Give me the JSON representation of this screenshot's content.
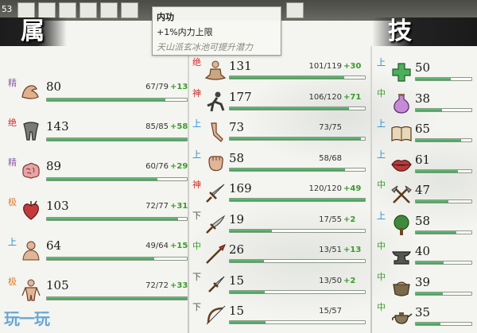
{
  "topbar": {
    "number": "53"
  },
  "sections": {
    "left_title": "属",
    "right_title": "技"
  },
  "tooltip": {
    "title": "内功",
    "effect": "+1%内力上限",
    "hint": "天山派玄冰池可提升潜力"
  },
  "watermark": "玩一玩",
  "colors": {
    "tier_jing": "#8b5fa8",
    "tier_jue": "#d42b2b",
    "tier_ji": "#e07a2a",
    "tier_shang": "#2a8fd0",
    "tier_shen": "#c8302a",
    "tier_xia": "#555555",
    "tier_zhong": "#3c9a2c",
    "bonus": "#3c9a2c",
    "bar_fill": "#4aa85f"
  },
  "attributes": [
    {
      "tier": "精",
      "tier_color": "tier_jing",
      "icon": "flexed-arm-icon",
      "value": "80",
      "current": 67,
      "max": 79,
      "fraction": "67/79",
      "bonus": "+13"
    },
    {
      "tier": "绝",
      "tier_color": "tier_jue",
      "icon": "legs-icon",
      "value": "143",
      "current": 85,
      "max": 85,
      "fraction": "85/85",
      "bonus": "+58"
    },
    {
      "tier": "精",
      "tier_color": "tier_jing",
      "icon": "brain-icon",
      "value": "89",
      "current": 60,
      "max": 76,
      "fraction": "60/76",
      "bonus": "+29"
    },
    {
      "tier": "极",
      "tier_color": "tier_ji",
      "icon": "heart-icon",
      "value": "103",
      "current": 72,
      "max": 77,
      "fraction": "72/77",
      "bonus": "+31"
    },
    {
      "tier": "上",
      "tier_color": "tier_shang",
      "icon": "bust-icon",
      "value": "64",
      "current": 49,
      "max": 64,
      "fraction": "49/64",
      "bonus": "+15"
    },
    {
      "tier": "极",
      "tier_color": "tier_ji",
      "icon": "body-icon",
      "value": "105",
      "current": 72,
      "max": 72,
      "fraction": "72/72",
      "bonus": "+33"
    }
  ],
  "martial": [
    {
      "tier": "绝",
      "tier_color": "tier_jue",
      "icon": "meditation-icon",
      "value": "131",
      "current": 101,
      "max": 119,
      "fraction": "101/119",
      "bonus": "+30"
    },
    {
      "tier": "神",
      "tier_color": "tier_shen",
      "icon": "leaping-figure-icon",
      "value": "177",
      "current": 106,
      "max": 120,
      "fraction": "106/120",
      "bonus": "+71"
    },
    {
      "tier": "上",
      "tier_color": "tier_shang",
      "icon": "kicking-leg-icon",
      "value": "73",
      "current": 73,
      "max": 75,
      "fraction": "73/75",
      "bonus": ""
    },
    {
      "tier": "上",
      "tier_color": "tier_shang",
      "icon": "fist-icon",
      "value": "58",
      "current": 58,
      "max": 68,
      "fraction": "58/68",
      "bonus": ""
    },
    {
      "tier": "神",
      "tier_color": "tier_shen",
      "icon": "sword-icon",
      "value": "169",
      "current": 120,
      "max": 120,
      "fraction": "120/120",
      "bonus": "+49"
    },
    {
      "tier": "下",
      "tier_color": "tier_xia",
      "icon": "broadsword-icon",
      "value": "19",
      "current": 17,
      "max": 55,
      "fraction": "17/55",
      "bonus": "+2"
    },
    {
      "tier": "中",
      "tier_color": "tier_zhong",
      "icon": "spear-icon",
      "value": "26",
      "current": 13,
      "max": 51,
      "fraction": "13/51",
      "bonus": "+13"
    },
    {
      "tier": "下",
      "tier_color": "tier_xia",
      "icon": "dagger-icon",
      "value": "15",
      "current": 13,
      "max": 50,
      "fraction": "13/50",
      "bonus": "+2"
    },
    {
      "tier": "下",
      "tier_color": "tier_xia",
      "icon": "bow-icon",
      "value": "15",
      "current": 15,
      "max": 57,
      "fraction": "15/57",
      "bonus": ""
    }
  ],
  "skills": [
    {
      "tier": "上",
      "tier_color": "tier_shang",
      "icon": "medical-cross-icon",
      "value": "50",
      "current": 50,
      "max": 80
    },
    {
      "tier": "中",
      "tier_color": "tier_zhong",
      "icon": "potion-flask-icon",
      "value": "38",
      "current": 38,
      "max": 80
    },
    {
      "tier": "上",
      "tier_color": "tier_shang",
      "icon": "book-icon",
      "value": "65",
      "current": 65,
      "max": 80
    },
    {
      "tier": "上",
      "tier_color": "tier_shang",
      "icon": "lips-icon",
      "value": "61",
      "current": 61,
      "max": 80
    },
    {
      "tier": "中",
      "tier_color": "tier_zhong",
      "icon": "crossed-axes-icon",
      "value": "47",
      "current": 47,
      "max": 80
    },
    {
      "tier": "上",
      "tier_color": "tier_shang",
      "icon": "tree-icon",
      "value": "58",
      "current": 58,
      "max": 80
    },
    {
      "tier": "中",
      "tier_color": "tier_zhong",
      "icon": "anvil-icon",
      "value": "40",
      "current": 40,
      "max": 80
    },
    {
      "tier": "中",
      "tier_color": "tier_zhong",
      "icon": "cooking-pot-icon",
      "value": "39",
      "current": 39,
      "max": 80
    },
    {
      "tier": "中",
      "tier_color": "tier_zhong",
      "icon": "teapot-icon",
      "value": "35",
      "current": 35,
      "max": 80
    }
  ]
}
